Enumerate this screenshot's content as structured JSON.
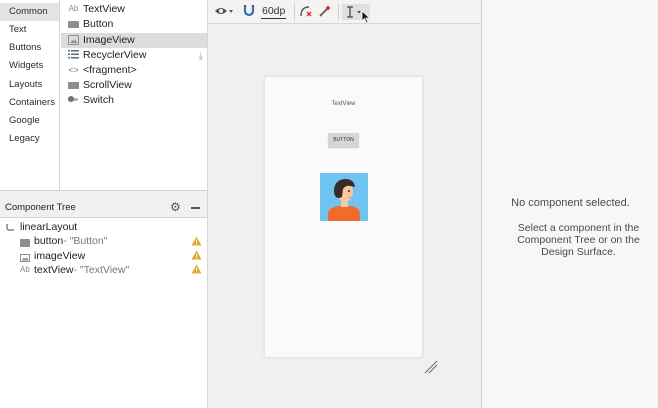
{
  "palette": {
    "categories": [
      "Common",
      "Text",
      "Buttons",
      "Widgets",
      "Layouts",
      "Containers",
      "Google",
      "Legacy"
    ],
    "selected_category": "Common",
    "widgets": [
      {
        "label": "TextView",
        "icon": "text-ab-icon"
      },
      {
        "label": "Button",
        "icon": "button-icon"
      },
      {
        "label": "ImageView",
        "icon": "image-icon"
      },
      {
        "label": "RecyclerView",
        "icon": "list-icon"
      },
      {
        "label": "<fragment>",
        "icon": "code-icon"
      },
      {
        "label": "ScrollView",
        "icon": "scroll-icon"
      },
      {
        "label": "Switch",
        "icon": "switch-icon"
      }
    ],
    "selected_widget": "ImageView"
  },
  "component_tree": {
    "title": "Component Tree",
    "root": "linearLayout",
    "children": [
      {
        "id": "button",
        "secondary": "- \"Button\"",
        "warning": true
      },
      {
        "id": "imageView",
        "secondary": "",
        "warning": true
      },
      {
        "id": "textView",
        "secondary": "- \"TextView\"",
        "warning": true
      }
    ]
  },
  "toolbar": {
    "margin_value": "60dp"
  },
  "preview": {
    "text_view": "TextView",
    "button_label": "BUTTON"
  },
  "attributes": {
    "empty_title": "No component selected.",
    "empty_hint": "Select a component in the Component Tree or on the Design Surface."
  },
  "colors": {
    "warning": "#e3a72f",
    "image_bg": "#6fc4ef",
    "selection": "#dcdcdc"
  }
}
